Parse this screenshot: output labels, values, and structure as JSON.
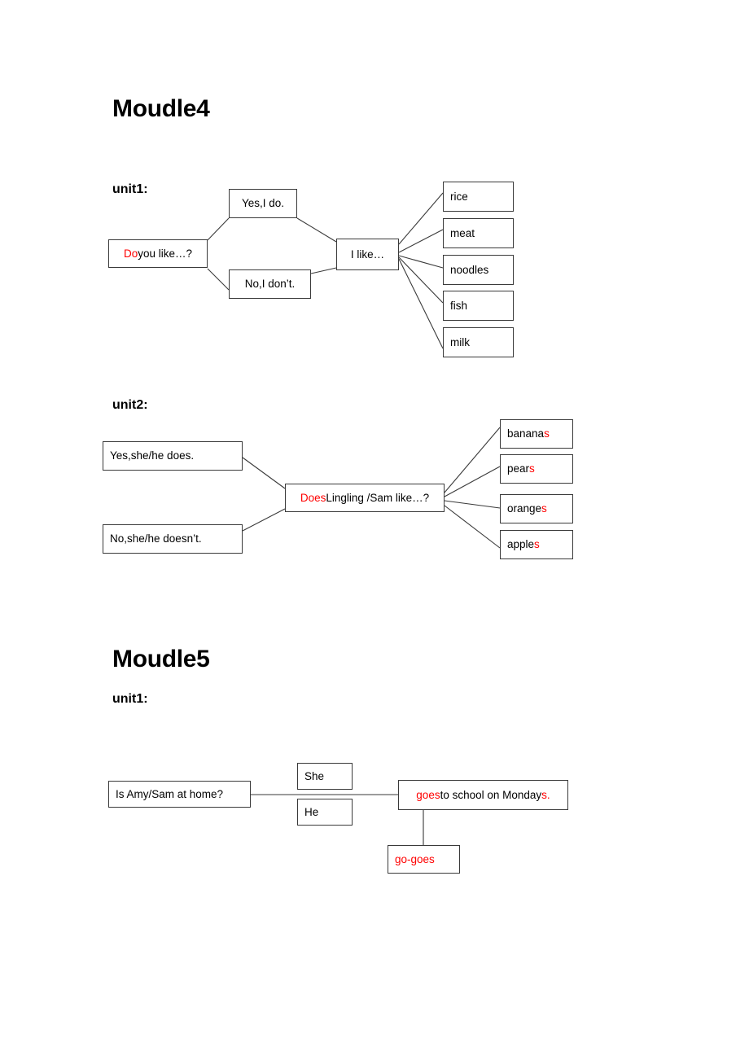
{
  "document": {
    "sections": [
      {
        "heading": "Moudle4",
        "units": [
          {
            "label": "unit1:"
          },
          {
            "label": "unit2:"
          }
        ]
      },
      {
        "heading": "Moudle5",
        "units": [
          {
            "label": "unit1:"
          }
        ]
      }
    ]
  },
  "colors": {
    "accent_red": "#ff0000",
    "text_black": "#000000",
    "box_border": "#3a3a3a",
    "background": "#ffffff"
  },
  "module4": {
    "heading": "Moudle4",
    "unit1": {
      "label": "unit1:",
      "question": {
        "red_part": "Do",
        "black_part": " you like…?",
        "full": "Do you like…?"
      },
      "answers": [
        {
          "text": "Yes,I do."
        },
        {
          "text": "No,I don’t."
        }
      ],
      "statement": {
        "text": "I like…"
      },
      "items": [
        {
          "text": "rice"
        },
        {
          "text": "meat"
        },
        {
          "text": "noodles"
        },
        {
          "text": "fish"
        },
        {
          "text": "milk"
        }
      ]
    },
    "unit2": {
      "label": "unit2:",
      "question": {
        "red_part": "Does",
        "black_part": " Lingling /Sam like…?",
        "full": "Does Lingling /Sam like…?"
      },
      "answers": [
        {
          "text": "Yes,she/he does."
        },
        {
          "text": "No,she/he doesn’t."
        }
      ],
      "items": [
        {
          "stem": "banana",
          "suffix": "s",
          "full": "bananas"
        },
        {
          "stem": "pear",
          "suffix": "s",
          "full": "pears"
        },
        {
          "stem": "orange",
          "suffix": "s",
          "full": "oranges"
        },
        {
          "stem": "apple",
          "suffix": "s",
          "full": "apples"
        }
      ]
    }
  },
  "module5": {
    "heading": "Moudle5",
    "unit1": {
      "label": "unit1:",
      "question": {
        "text": "Is Amy/Sam at home?"
      },
      "subjects": [
        {
          "text": "She"
        },
        {
          "text": "He"
        }
      ],
      "predicate": {
        "red_verb": "goes",
        "black_middle": " to school on Monday",
        "red_suffix": "s.",
        "full": "goes to school on Mondays."
      },
      "note": {
        "text": "go-goes"
      }
    }
  }
}
